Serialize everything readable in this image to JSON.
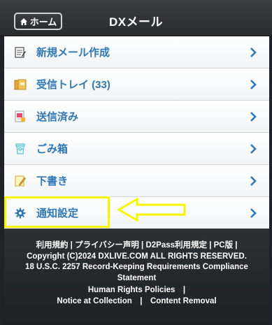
{
  "header": {
    "home_label": "ホーム",
    "title": "DXメール"
  },
  "menu": {
    "items": [
      {
        "label": "新規メール作成",
        "icon": "compose-icon"
      },
      {
        "label": "受信トレイ (33)",
        "icon": "inbox-icon"
      },
      {
        "label": "送信済み",
        "icon": "sent-icon"
      },
      {
        "label": "ごみ箱",
        "icon": "trash-icon"
      },
      {
        "label": "下書き",
        "icon": "draft-icon"
      },
      {
        "label": "通知設定",
        "icon": "gear-icon"
      }
    ]
  },
  "footer": {
    "line1": "利用規約 | プライバシー声明 | D2Pass利用規定 | PC版 |",
    "line2": "Copyright (C)2024 DXLIVE.COM ALL RIGHTS RESERVED.",
    "line3": "18 U.S.C. 2257 Record-Keeping Requirements Compliance",
    "line4": "Statement",
    "line5": "Human Rights Policies　|",
    "line6": "Notice at Collection　|　Content Removal"
  },
  "colors": {
    "accent_text": "#2f78b5",
    "highlight": "#f5f500",
    "header_bg": "#2a2c2f"
  }
}
